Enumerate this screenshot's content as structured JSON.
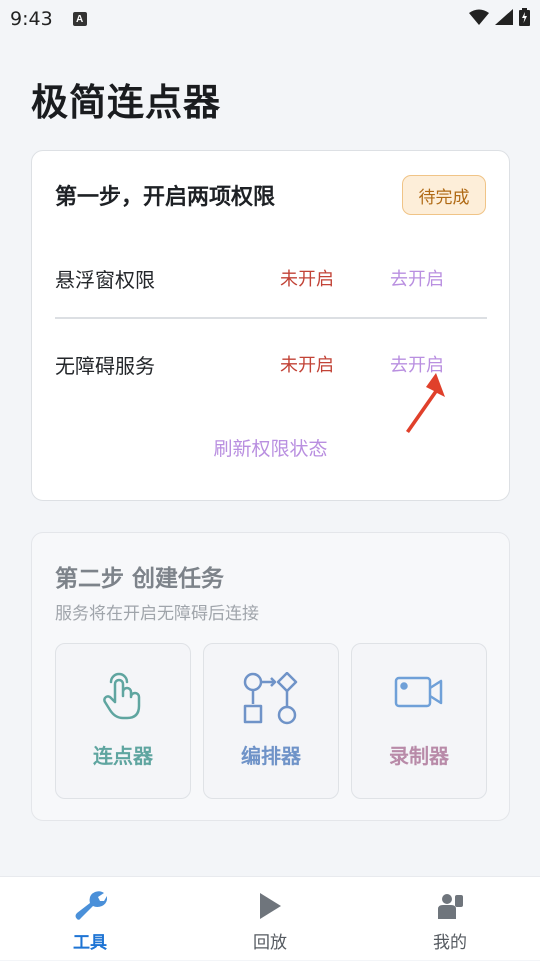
{
  "status_bar": {
    "time": "9:43",
    "badge": "A"
  },
  "app": {
    "title": "极简连点器"
  },
  "step1": {
    "title": "第一步，开启两项权限",
    "badge": "待完成",
    "permissions": [
      {
        "name": "悬浮窗权限",
        "status": "未开启",
        "action": "去开启"
      },
      {
        "name": "无障碍服务",
        "status": "未开启",
        "action": "去开启"
      }
    ],
    "refresh": "刷新权限状态"
  },
  "step2": {
    "title": "第二步 创建任务",
    "subtitle": "服务将在开启无障碍后连接",
    "tools": [
      {
        "label": "连点器",
        "icon": "tap-hand-icon",
        "color": "#5fa5a0"
      },
      {
        "label": "编排器",
        "icon": "flowchart-icon",
        "color": "#6f93c8"
      },
      {
        "label": "录制器",
        "icon": "video-camera-icon",
        "color": "#b88aa8"
      }
    ]
  },
  "tabbar": {
    "tabs": [
      {
        "label": "工具",
        "icon": "wrench-icon",
        "active": true
      },
      {
        "label": "回放",
        "icon": "play-icon",
        "active": false
      },
      {
        "label": "我的",
        "icon": "user-icon",
        "active": false
      }
    ]
  },
  "colors": {
    "accent": "#1e74d4",
    "danger": "#c24337",
    "link": "#b98fe0",
    "pending_bg": "#fdeed9",
    "pending_text": "#b06a15"
  }
}
